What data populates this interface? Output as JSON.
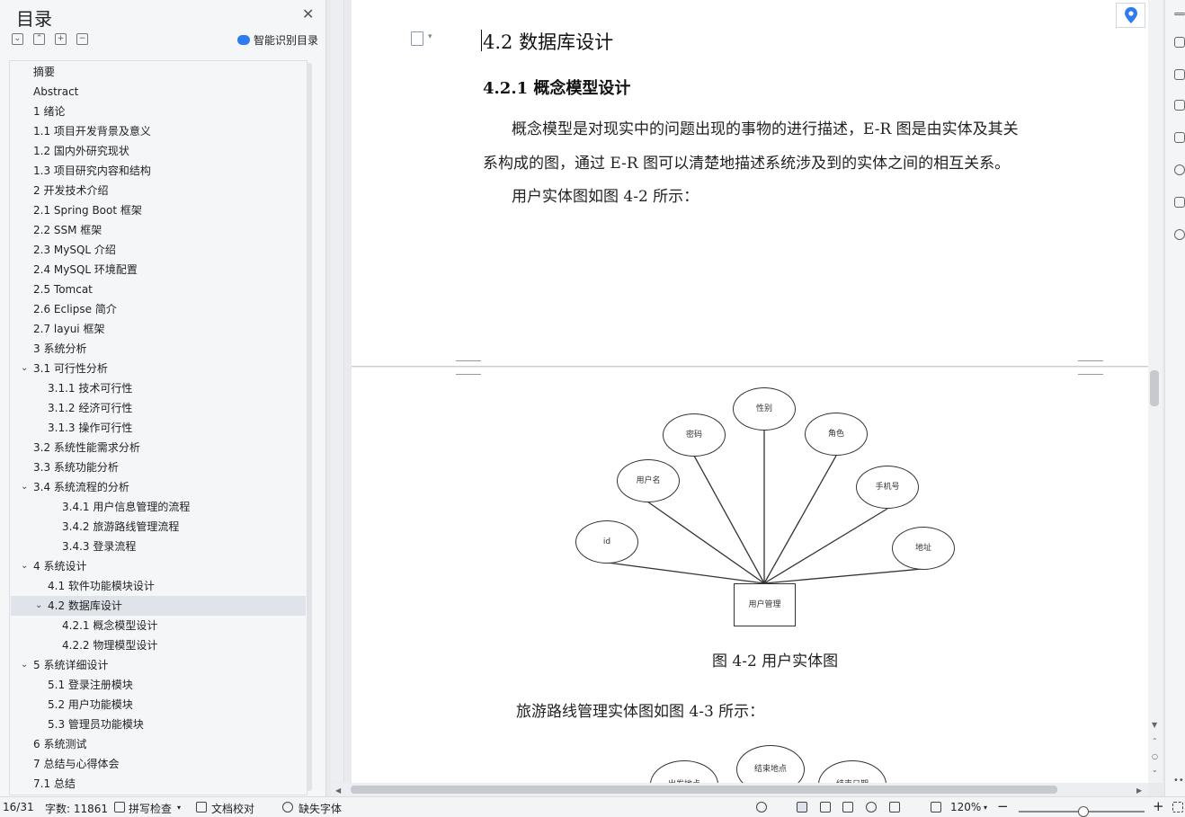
{
  "toc": {
    "title": "目录",
    "smart_label": "智能识别目录",
    "items": [
      {
        "label": "摘要",
        "level": 1,
        "expand": ""
      },
      {
        "label": "Abstract",
        "level": 1,
        "expand": ""
      },
      {
        "label": "1 绪论",
        "level": 1,
        "expand": ""
      },
      {
        "label": "1.1 项目开发背景及意义",
        "level": 1,
        "expand": ""
      },
      {
        "label": "1.2 国内外研究现状",
        "level": 1,
        "expand": ""
      },
      {
        "label": "1.3 项目研究内容和结构",
        "level": 1,
        "expand": ""
      },
      {
        "label": "2 开发技术介绍",
        "level": 1,
        "expand": ""
      },
      {
        "label": "2.1 Spring Boot 框架",
        "level": 1,
        "expand": ""
      },
      {
        "label": "2.2 SSM 框架",
        "level": 1,
        "expand": ""
      },
      {
        "label": "2.3 MySQL  介绍",
        "level": 1,
        "expand": ""
      },
      {
        "label": "2.4 MySQL 环境配置",
        "level": 1,
        "expand": ""
      },
      {
        "label": "2.5 Tomcat",
        "level": 1,
        "expand": ""
      },
      {
        "label": "2.6 Eclipse 简介",
        "level": 1,
        "expand": ""
      },
      {
        "label": "2.7 layui 框架",
        "level": 1,
        "expand": ""
      },
      {
        "label": "3 系统分析",
        "level": 1,
        "expand": ""
      },
      {
        "label": "3.1 可行性分析",
        "level": 1,
        "expand": "v"
      },
      {
        "label": "3.1.1 技术可行性",
        "level": 2,
        "expand": ""
      },
      {
        "label": "3.1.2 经济可行性",
        "level": 2,
        "expand": ""
      },
      {
        "label": "3.1.3 操作可行性",
        "level": 2,
        "expand": ""
      },
      {
        "label": "3.2 系统性能需求分析",
        "level": 1,
        "expand": ""
      },
      {
        "label": "3.3 系统功能分析",
        "level": 1,
        "expand": ""
      },
      {
        "label": "3.4 系统流程的分析",
        "level": 1,
        "expand": "v"
      },
      {
        "label": "3.4.1  用户信息管理的流程",
        "level": 3,
        "expand": ""
      },
      {
        "label": "3.4.2 旅游路线管理流程",
        "level": 3,
        "expand": ""
      },
      {
        "label": "3.4.3  登录流程",
        "level": 3,
        "expand": ""
      },
      {
        "label": "4 系统设计",
        "level": 1,
        "expand": "v"
      },
      {
        "label": "4.1  软件功能模块设计",
        "level": 2,
        "expand": ""
      },
      {
        "label": "4.2 数据库设计",
        "level": 2,
        "expand": "v"
      },
      {
        "label": "4.2.1 概念模型设计",
        "level": 3,
        "expand": ""
      },
      {
        "label": "4.2.2 物理模型设计",
        "level": 3,
        "expand": ""
      },
      {
        "label": "5 系统详细设计",
        "level": 1,
        "expand": "v"
      },
      {
        "label": "5.1 登录注册模块",
        "level": 2,
        "expand": ""
      },
      {
        "label": "5.2 用户功能模块",
        "level": 2,
        "expand": ""
      },
      {
        "label": "5.3 管理员功能模块",
        "level": 2,
        "expand": ""
      },
      {
        "label": "6 系统测试",
        "level": 1,
        "expand": ""
      },
      {
        "label": "7 总结与心得体会",
        "level": 1,
        "expand": ""
      },
      {
        "label": "7.1  总结",
        "level": 1,
        "expand": ""
      }
    ],
    "active_index": 27
  },
  "doc": {
    "h2": "4.2 数据库设计",
    "h3": "4.2.1 概念模型设计",
    "p1_line1": "概念模型是对现实中的问题出现的事物的进行描述，E-R 图是由实体及其关",
    "p1_line2": "系构成的图，通过 E-R 图可以清楚地描述系统涉及到的实体之间的相互关系。",
    "p2": "用户实体图如图 4-2 所示：",
    "er": {
      "entity": "用户管理",
      "attributes": [
        "id",
        "用户名",
        "密码",
        "性别",
        "角色",
        "手机号",
        "地址"
      ]
    },
    "caption": "图 4-2 用户实体图",
    "p3": "旅游路线管理实体图如图 4-3 所示：",
    "er2_attributes": [
      "出发地点",
      "结束地点",
      "结束日期"
    ]
  },
  "status": {
    "page": "16/31",
    "word_count": "字数: 11861",
    "spell_check": "拼写检查",
    "doc_proof": "文档校对",
    "missing_font": "缺失字体",
    "zoom": "120%"
  }
}
